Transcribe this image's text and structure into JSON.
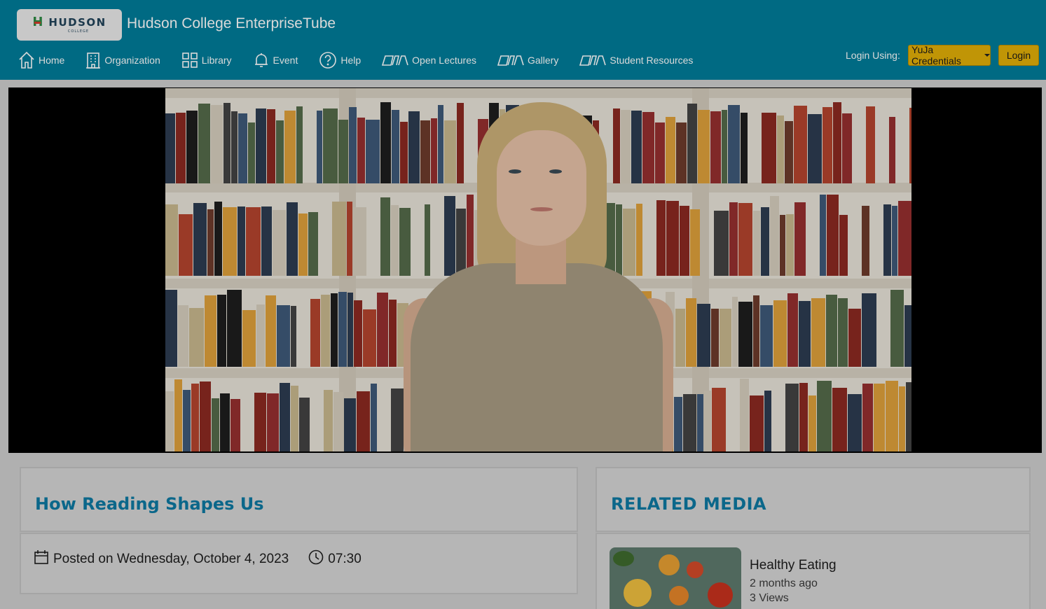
{
  "header": {
    "logo_text": "HUDSON",
    "logo_subtext": "COLLEGE",
    "site_title": "Hudson College EnterpriseTube",
    "nav": [
      {
        "label": "Home",
        "icon": "home-icon"
      },
      {
        "label": "Organization",
        "icon": "building-icon"
      },
      {
        "label": "Library",
        "icon": "grid-icon"
      },
      {
        "label": "Event",
        "icon": "bell-icon"
      },
      {
        "label": "Help",
        "icon": "help-icon"
      },
      {
        "label": "Open Lectures",
        "icon": "books-icon"
      },
      {
        "label": "Gallery",
        "icon": "books-icon"
      },
      {
        "label": "Student Resources",
        "icon": "books-icon"
      }
    ],
    "login_label": "Login Using:",
    "credentials_select": "YuJa Credentials",
    "login_button": "Login"
  },
  "video": {
    "title": "How Reading Shapes Us",
    "posted": "Posted on Wednesday, October 4, 2023",
    "duration": "07:30"
  },
  "related": {
    "heading": "RELATED MEDIA",
    "items": [
      {
        "title": "Healthy Eating",
        "ago": "2 months ago",
        "views": "3 Views"
      }
    ]
  },
  "colors": {
    "header_bg": "#007d9a",
    "accent_button": "#e2b008",
    "title_color": "#0e7aa3"
  }
}
